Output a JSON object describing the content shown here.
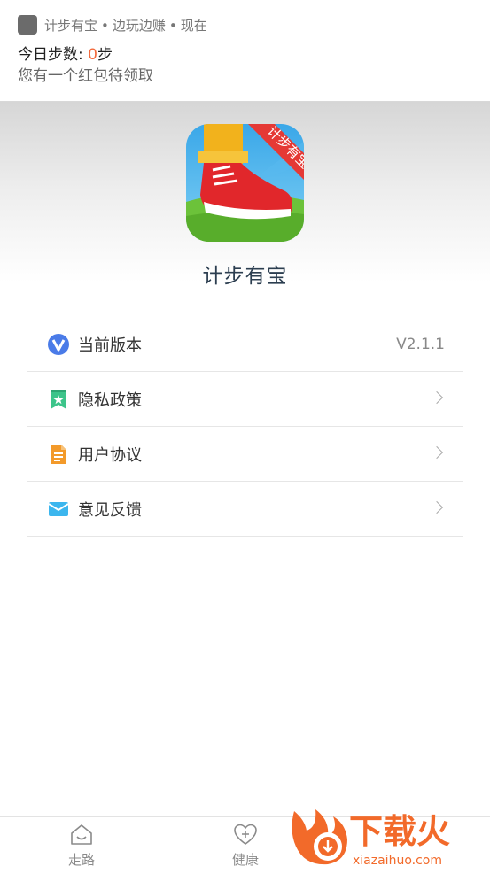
{
  "notification": {
    "app_name": "计步有宝",
    "sep1": "•",
    "tagline": "边玩边赚",
    "sep2": "•",
    "time": "现在",
    "title_prefix": "今日步数: ",
    "step_count": "0",
    "title_suffix": "步",
    "body": "您有一个红包待领取"
  },
  "app": {
    "logo_badge": "计步有宝",
    "name": "计步有宝"
  },
  "menu": {
    "items": [
      {
        "label": "当前版本",
        "value": "V2.1.1",
        "icon": "v-badge-icon"
      },
      {
        "label": "隐私政策",
        "icon": "bookmark-star-icon"
      },
      {
        "label": "用户协议",
        "icon": "document-icon"
      },
      {
        "label": "意见反馈",
        "icon": "mail-icon"
      }
    ]
  },
  "bottom_nav": {
    "items": [
      {
        "label": "走路",
        "icon": "home-smile-icon"
      },
      {
        "label": "健康",
        "icon": "heart-plus-icon"
      }
    ]
  },
  "watermark": {
    "brand": "下载火",
    "domain": "xiazaihuo.com"
  },
  "colors": {
    "accent_orange": "#f36a3c",
    "title_navy": "#2c3e50",
    "watermark_orange": "#f26a2a"
  }
}
